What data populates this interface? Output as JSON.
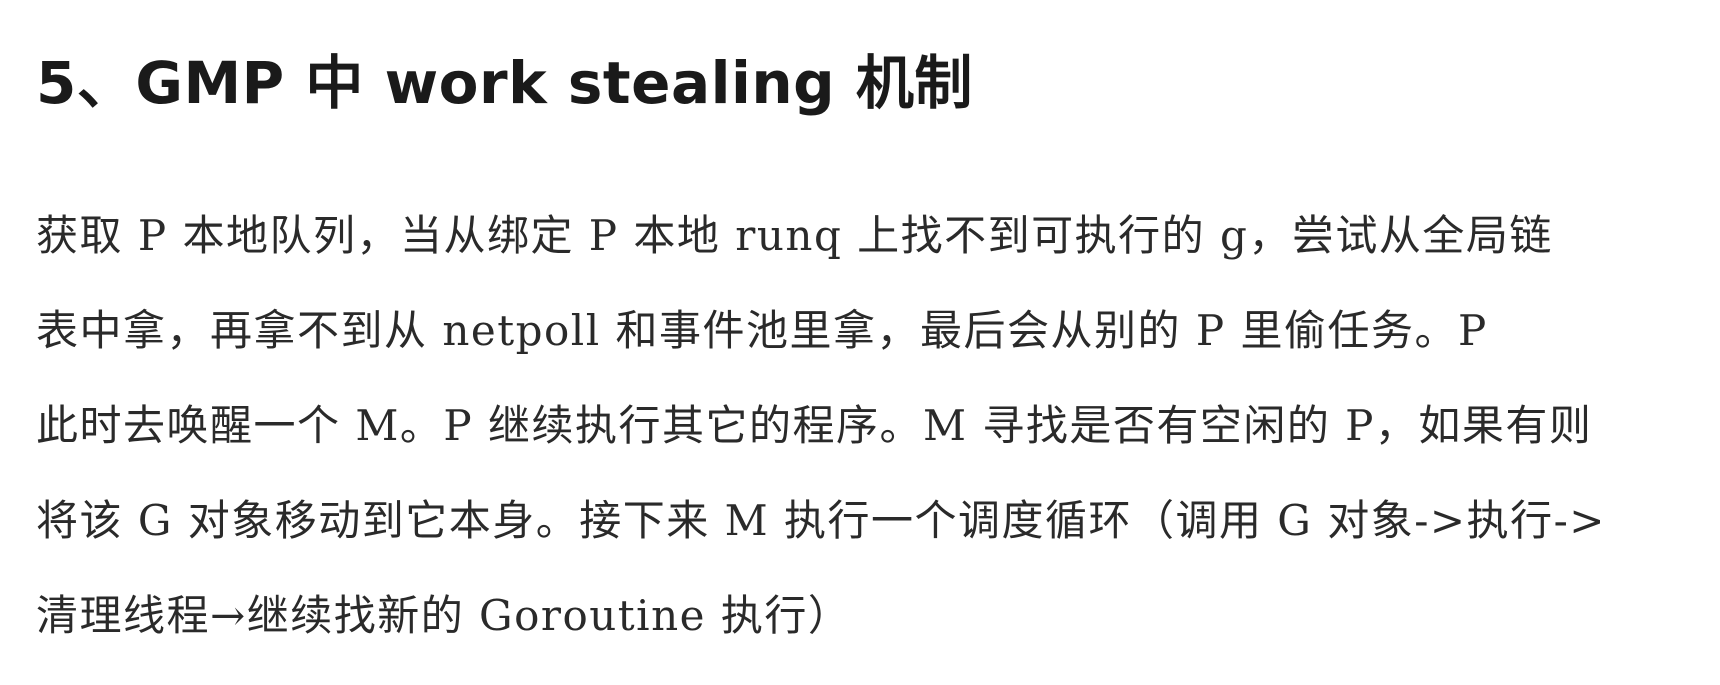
{
  "document": {
    "heading": "5、GMP 中 work stealing 机制",
    "paragraph_lines": [
      "获取 P 本地队列，当从绑定 P 本地 runq 上找不到可执行的 g，尝试从全局链",
      "表中拿，再拿不到从 netpoll 和事件池里拿，最后会从别的 P 里偷任务。P",
      "此时去唤醒一个 M。P 继续执行其它的程序。M 寻找是否有空闲的 P，如果有则",
      "将该 G 对象移动到它本身。接下来 M 执行一个调度循环（调用 G 对象->执行->",
      "清理线程→继续找新的 Goroutine 执行）"
    ]
  }
}
